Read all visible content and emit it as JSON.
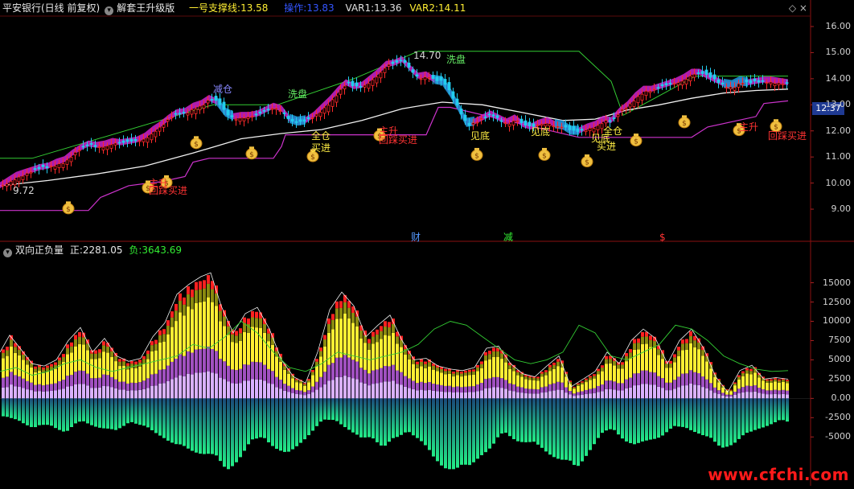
{
  "window": {
    "stock_title": "平安银行(日线 前复权)",
    "indicator_name": "解套王升级版",
    "support_label": "一号支撑线:",
    "support_value": "13.58",
    "operate_label": "操作:",
    "operate_value": "13.83",
    "var1_label": "VAR1:",
    "var1_value": "13.36",
    "var2_label": "VAR2:",
    "var2_value": "14.11",
    "win_controls": "◇  ×",
    "last_price_tag": "12.37"
  },
  "sub_panel": {
    "indicator_name": "双向正负量",
    "pos_label": "正:",
    "pos_value": "2281.05",
    "neg_label": "负:",
    "neg_value": "3643.69"
  },
  "watermark": "www.cfchi.com",
  "chart_data": {
    "type": "candlestick",
    "price_axis": {
      "ylim": [
        8.2,
        16.4
      ],
      "ticks": [
        9.0,
        10.0,
        11.0,
        12.0,
        13.0,
        14.0,
        15.0,
        16.0
      ],
      "tick_labels": [
        "9.00",
        "10.00",
        "11.00",
        "12.00",
        "13.00",
        "14.00",
        "15.00",
        "16.00"
      ]
    },
    "volume_axis": {
      "ylim": [
        -10500,
        18500
      ],
      "ticks": [
        -5000,
        -2500,
        0,
        2500,
        5000,
        7500,
        10000,
        12500,
        15000
      ],
      "tick_labels": [
        "-5000",
        "-2500",
        "0.00",
        "2500",
        "5000",
        "7500",
        "10000",
        "12500",
        "15000"
      ]
    },
    "price_points": [
      [
        0,
        9.85
      ],
      [
        10,
        10.05
      ],
      [
        20,
        10.25
      ],
      [
        30,
        10.35
      ],
      [
        40,
        10.45
      ],
      [
        50,
        10.55
      ],
      [
        60,
        10.6
      ],
      [
        70,
        10.75
      ],
      [
        80,
        10.85
      ],
      [
        90,
        11.1
      ],
      [
        100,
        11.3
      ],
      [
        110,
        11.45
      ],
      [
        120,
        11.4
      ],
      [
        130,
        11.45
      ],
      [
        140,
        11.55
      ],
      [
        150,
        11.5
      ],
      [
        160,
        11.55
      ],
      [
        170,
        11.6
      ],
      [
        180,
        11.75
      ],
      [
        190,
        12.0
      ],
      [
        200,
        12.2
      ],
      [
        210,
        12.45
      ],
      [
        220,
        12.65
      ],
      [
        230,
        12.7
      ],
      [
        240,
        12.9
      ],
      [
        250,
        13.0
      ],
      [
        260,
        13.2
      ],
      [
        270,
        13.05
      ],
      [
        280,
        12.65
      ],
      [
        290,
        12.5
      ],
      [
        300,
        12.55
      ],
      [
        310,
        12.55
      ],
      [
        320,
        12.6
      ],
      [
        330,
        12.75
      ],
      [
        340,
        12.9
      ],
      [
        350,
        12.8
      ],
      [
        360,
        12.4
      ],
      [
        370,
        12.3
      ],
      [
        380,
        12.35
      ],
      [
        390,
        12.55
      ],
      [
        400,
        12.85
      ],
      [
        410,
        13.15
      ],
      [
        420,
        13.5
      ],
      [
        430,
        13.8
      ],
      [
        440,
        13.65
      ],
      [
        450,
        13.7
      ],
      [
        460,
        13.95
      ],
      [
        470,
        14.2
      ],
      [
        480,
        14.5
      ],
      [
        490,
        14.55
      ],
      [
        500,
        14.68
      ],
      [
        510,
        14.35
      ],
      [
        520,
        14.05
      ],
      [
        530,
        14.1
      ],
      [
        540,
        13.9
      ],
      [
        550,
        13.85
      ],
      [
        560,
        13.4
      ],
      [
        570,
        12.85
      ],
      [
        580,
        12.25
      ],
      [
        590,
        12.3
      ],
      [
        600,
        12.45
      ],
      [
        610,
        12.6
      ],
      [
        620,
        12.45
      ],
      [
        630,
        12.3
      ],
      [
        640,
        12.45
      ],
      [
        650,
        12.2
      ],
      [
        660,
        12.1
      ],
      [
        670,
        12.25
      ],
      [
        680,
        12.35
      ],
      [
        690,
        12.2
      ],
      [
        700,
        12.15
      ],
      [
        710,
        11.95
      ],
      [
        720,
        11.95
      ],
      [
        730,
        12.1
      ],
      [
        740,
        12.2
      ],
      [
        750,
        12.4
      ],
      [
        760,
        12.35
      ],
      [
        770,
        12.7
      ],
      [
        780,
        12.95
      ],
      [
        790,
        13.3
      ],
      [
        800,
        13.55
      ],
      [
        810,
        13.55
      ],
      [
        820,
        13.65
      ],
      [
        830,
        13.75
      ],
      [
        840,
        13.85
      ],
      [
        850,
        14.0
      ],
      [
        860,
        14.2
      ],
      [
        870,
        14.2
      ],
      [
        880,
        14.05
      ],
      [
        890,
        13.9
      ],
      [
        900,
        13.75
      ],
      [
        910,
        13.7
      ],
      [
        920,
        13.85
      ],
      [
        930,
        13.8
      ],
      [
        940,
        13.85
      ],
      [
        950,
        13.9
      ],
      [
        960,
        13.9
      ],
      [
        970,
        13.85
      ],
      [
        980,
        13.8
      ]
    ],
    "ma_slow": [
      [
        0,
        9.9
      ],
      [
        60,
        10.1
      ],
      [
        120,
        10.35
      ],
      [
        180,
        10.65
      ],
      [
        240,
        11.15
      ],
      [
        300,
        11.7
      ],
      [
        350,
        11.9
      ],
      [
        400,
        12.05
      ],
      [
        450,
        12.4
      ],
      [
        500,
        12.85
      ],
      [
        550,
        13.1
      ],
      [
        600,
        13.0
      ],
      [
        650,
        12.7
      ],
      [
        700,
        12.4
      ],
      [
        740,
        12.45
      ],
      [
        780,
        12.8
      ],
      [
        820,
        13.0
      ],
      [
        860,
        13.25
      ],
      [
        900,
        13.45
      ],
      [
        940,
        13.55
      ],
      [
        980,
        13.6
      ]
    ],
    "ma_stair": [
      [
        0,
        8.95
      ],
      [
        110,
        8.95
      ],
      [
        125,
        9.45
      ],
      [
        160,
        9.9
      ],
      [
        185,
        10.0
      ],
      [
        200,
        10.05
      ],
      [
        230,
        10.25
      ],
      [
        240,
        10.8
      ],
      [
        260,
        10.95
      ],
      [
        340,
        10.95
      ],
      [
        350,
        11.4
      ],
      [
        355,
        11.85
      ],
      [
        530,
        11.85
      ],
      [
        545,
        12.9
      ],
      [
        560,
        12.9
      ],
      [
        720,
        11.75
      ],
      [
        860,
        11.75
      ],
      [
        880,
        12.15
      ],
      [
        940,
        12.55
      ],
      [
        950,
        13.05
      ],
      [
        980,
        13.15
      ]
    ],
    "resistance": [
      [
        0,
        10.95
      ],
      [
        40,
        10.95
      ],
      [
        265,
        13.0
      ],
      [
        345,
        13.0
      ],
      [
        440,
        14.0
      ],
      [
        520,
        15.05
      ],
      [
        720,
        15.05
      ],
      [
        760,
        13.9
      ],
      [
        775,
        12.6
      ],
      [
        865,
        14.1
      ],
      [
        980,
        14.1
      ]
    ],
    "annotations": [
      {
        "text": "减仓",
        "x": 267,
        "y": 13.6,
        "color": "#8888ff"
      },
      {
        "text": "洗盘",
        "x": 360,
        "y": 13.4,
        "color": "#66ee66"
      },
      {
        "text": "洗盘",
        "x": 557,
        "y": 14.75,
        "color": "#66ee66"
      },
      {
        "text": "14.70",
        "x": 516,
        "y": 14.9,
        "color": "#d8d8d8"
      },
      {
        "text": "9.72",
        "x": 18,
        "y": 9.72,
        "color": "#d8d8d8"
      },
      {
        "text": "主升",
        "x": 187,
        "y": 10.0,
        "color": "#ff3333"
      },
      {
        "text": "回踩买进",
        "x": 187,
        "y": 9.72,
        "color": "#ff3333"
      },
      {
        "text": "全仓",
        "x": 389,
        "y": 11.8,
        "color": "#ffee44"
      },
      {
        "text": "买进",
        "x": 389,
        "y": 11.35,
        "color": "#ffee44"
      },
      {
        "text": "主升",
        "x": 473,
        "y": 12.0,
        "color": "#ff3333"
      },
      {
        "text": "回踩买进",
        "x": 473,
        "y": 11.65,
        "color": "#ff3333"
      },
      {
        "text": "见底",
        "x": 587,
        "y": 11.8,
        "color": "#ffee44"
      },
      {
        "text": "见底",
        "x": 662,
        "y": 11.95,
        "color": "#ffee44"
      },
      {
        "text": "见底",
        "x": 737,
        "y": 11.7,
        "color": "#ffee44"
      },
      {
        "text": "买进",
        "x": 744,
        "y": 11.4,
        "color": "#ffee44"
      },
      {
        "text": "全仓",
        "x": 752,
        "y": 12.0,
        "color": "#ffee44"
      },
      {
        "text": "主升",
        "x": 921,
        "y": 12.15,
        "color": "#ff3333"
      },
      {
        "text": "回踩买进",
        "x": 957,
        "y": 11.8,
        "color": "#ff3333"
      }
    ],
    "money_bags": [
      [
        85,
        9.05
      ],
      [
        184,
        9.85
      ],
      [
        207,
        10.05
      ],
      [
        244,
        11.55
      ],
      [
        313,
        11.15
      ],
      [
        389,
        11.05
      ],
      [
        472,
        11.85
      ],
      [
        593,
        11.1
      ],
      [
        677,
        11.1
      ],
      [
        730,
        10.85
      ],
      [
        791,
        11.65
      ],
      [
        851,
        12.35
      ],
      [
        919,
        12.05
      ],
      [
        965,
        12.2
      ]
    ],
    "markers": [
      {
        "text": "财",
        "x": 517,
        "color": "#5599ff"
      },
      {
        "text": "减",
        "x": 632,
        "color": "#33ee33"
      },
      {
        "text": "$",
        "x": 826,
        "color": "#ff3333"
      }
    ],
    "volume_envelope": [
      [
        0,
        6000
      ],
      [
        12,
        8200
      ],
      [
        25,
        6500
      ],
      [
        40,
        4500
      ],
      [
        55,
        4200
      ],
      [
        70,
        5000
      ],
      [
        85,
        7500
      ],
      [
        100,
        9200
      ],
      [
        115,
        6000
      ],
      [
        130,
        7800
      ],
      [
        145,
        5500
      ],
      [
        160,
        4800
      ],
      [
        175,
        5200
      ],
      [
        190,
        8000
      ],
      [
        205,
        9800
      ],
      [
        220,
        13500
      ],
      [
        235,
        14800
      ],
      [
        250,
        15800
      ],
      [
        262,
        16300
      ],
      [
        275,
        12000
      ],
      [
        290,
        8500
      ],
      [
        305,
        11000
      ],
      [
        320,
        11800
      ],
      [
        335,
        9000
      ],
      [
        350,
        5000
      ],
      [
        365,
        2800
      ],
      [
        380,
        2000
      ],
      [
        395,
        6000
      ],
      [
        410,
        11500
      ],
      [
        425,
        13800
      ],
      [
        440,
        12000
      ],
      [
        455,
        8000
      ],
      [
        470,
        9500
      ],
      [
        485,
        10800
      ],
      [
        500,
        7500
      ],
      [
        515,
        5000
      ],
      [
        530,
        5200
      ],
      [
        545,
        4200
      ],
      [
        560,
        3800
      ],
      [
        575,
        3600
      ],
      [
        590,
        4000
      ],
      [
        605,
        6500
      ],
      [
        620,
        6800
      ],
      [
        635,
        4500
      ],
      [
        650,
        3200
      ],
      [
        665,
        2800
      ],
      [
        680,
        4200
      ],
      [
        695,
        5500
      ],
      [
        710,
        1500
      ],
      [
        725,
        2500
      ],
      [
        740,
        3500
      ],
      [
        755,
        6000
      ],
      [
        770,
        4500
      ],
      [
        785,
        7500
      ],
      [
        800,
        9000
      ],
      [
        815,
        7800
      ],
      [
        830,
        4500
      ],
      [
        845,
        7500
      ],
      [
        860,
        9000
      ],
      [
        875,
        6500
      ],
      [
        890,
        2800
      ],
      [
        905,
        800
      ],
      [
        920,
        3600
      ],
      [
        935,
        4300
      ],
      [
        950,
        2500
      ],
      [
        965,
        2700
      ],
      [
        980,
        2500
      ]
    ],
    "volume_neg_envelope": [
      [
        0,
        -2500
      ],
      [
        20,
        -2800
      ],
      [
        40,
        -4000
      ],
      [
        60,
        -3500
      ],
      [
        80,
        -4500
      ],
      [
        100,
        -3000
      ],
      [
        120,
        -3800
      ],
      [
        140,
        -4500
      ],
      [
        160,
        -3000
      ],
      [
        180,
        -4000
      ],
      [
        200,
        -5000
      ],
      [
        220,
        -6500
      ],
      [
        240,
        -7000
      ],
      [
        260,
        -7500
      ],
      [
        280,
        -9500
      ],
      [
        295,
        -8000
      ],
      [
        310,
        -6000
      ],
      [
        325,
        -5000
      ],
      [
        340,
        -6500
      ],
      [
        355,
        -7800
      ],
      [
        370,
        -6000
      ],
      [
        385,
        -4500
      ],
      [
        400,
        -3000
      ],
      [
        415,
        -2800
      ],
      [
        430,
        -4000
      ],
      [
        445,
        -5500
      ],
      [
        460,
        -5000
      ],
      [
        475,
        -6500
      ],
      [
        490,
        -5500
      ],
      [
        505,
        -4200
      ],
      [
        520,
        -5500
      ],
      [
        535,
        -7800
      ],
      [
        550,
        -9000
      ],
      [
        565,
        -9500
      ],
      [
        580,
        -9300
      ],
      [
        595,
        -7500
      ],
      [
        610,
        -6500
      ],
      [
        625,
        -4500
      ],
      [
        640,
        -5500
      ],
      [
        655,
        -6000
      ],
      [
        670,
        -6500
      ],
      [
        685,
        -7500
      ],
      [
        700,
        -8500
      ],
      [
        715,
        -9300
      ],
      [
        730,
        -7000
      ],
      [
        745,
        -5000
      ],
      [
        760,
        -4000
      ],
      [
        775,
        -5500
      ],
      [
        790,
        -6500
      ],
      [
        805,
        -5500
      ],
      [
        820,
        -5000
      ],
      [
        835,
        -4000
      ],
      [
        850,
        -3800
      ],
      [
        865,
        -4500
      ],
      [
        880,
        -5500
      ],
      [
        895,
        -6500
      ],
      [
        910,
        -6000
      ],
      [
        925,
        -5000
      ],
      [
        940,
        -4000
      ],
      [
        955,
        -3500
      ],
      [
        970,
        -3000
      ],
      [
        980,
        -3200
      ]
    ],
    "volume_line": [
      [
        0,
        3500
      ],
      [
        20,
        4000
      ],
      [
        40,
        3000
      ],
      [
        60,
        3500
      ],
      [
        80,
        4500
      ],
      [
        100,
        5000
      ],
      [
        120,
        4000
      ],
      [
        140,
        3500
      ],
      [
        160,
        4000
      ],
      [
        180,
        4500
      ],
      [
        200,
        5000
      ],
      [
        220,
        5500
      ],
      [
        240,
        7000
      ],
      [
        260,
        6500
      ],
      [
        280,
        8000
      ],
      [
        300,
        10000
      ],
      [
        320,
        8500
      ],
      [
        340,
        6000
      ],
      [
        360,
        4000
      ],
      [
        380,
        3500
      ],
      [
        400,
        4500
      ],
      [
        420,
        6000
      ],
      [
        440,
        5500
      ],
      [
        460,
        5000
      ],
      [
        480,
        5500
      ],
      [
        500,
        6000
      ],
      [
        520,
        7000
      ],
      [
        540,
        9000
      ],
      [
        560,
        10000
      ],
      [
        580,
        9500
      ],
      [
        600,
        8000
      ],
      [
        620,
        6500
      ],
      [
        640,
        5000
      ],
      [
        660,
        4500
      ],
      [
        680,
        5000
      ],
      [
        700,
        6000
      ],
      [
        720,
        9500
      ],
      [
        740,
        8500
      ],
      [
        760,
        5500
      ],
      [
        780,
        5000
      ],
      [
        800,
        6000
      ],
      [
        820,
        7000
      ],
      [
        840,
        9500
      ],
      [
        860,
        9000
      ],
      [
        880,
        7500
      ],
      [
        900,
        5500
      ],
      [
        920,
        4500
      ],
      [
        940,
        3800
      ],
      [
        960,
        3500
      ],
      [
        980,
        3600
      ]
    ]
  }
}
